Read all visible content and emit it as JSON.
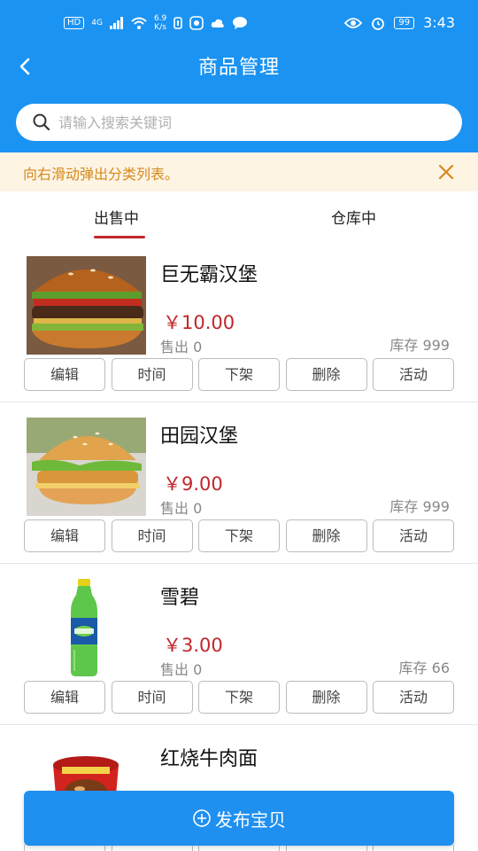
{
  "status_bar": {
    "hd": "HD",
    "net": "4G",
    "speed_value": "6.9",
    "speed_unit": "K/s",
    "battery": "99",
    "time": "3:43"
  },
  "header": {
    "title": "商品管理",
    "background_color": "#1b93f2"
  },
  "search": {
    "placeholder": "请输入搜索关键词",
    "value": ""
  },
  "notice": {
    "text": "向右滑动弹出分类列表。",
    "color": "#d58a1a"
  },
  "tabs": [
    {
      "label": "出售中",
      "active": true
    },
    {
      "label": "仓库中",
      "active": false
    }
  ],
  "products": [
    {
      "name": "巨无霸汉堡",
      "price": "￥10.00",
      "sold": "售出 0",
      "stock": "库存 999",
      "image": "burger-image"
    },
    {
      "name": "田园汉堡",
      "price": "￥9.00",
      "sold": "售出 0",
      "stock": "库存 999",
      "image": "chicken-burger-image"
    },
    {
      "name": "雪碧",
      "price": "￥3.00",
      "sold": "售出 0",
      "stock": "库存 66",
      "image": "sprite-bottle-image"
    },
    {
      "name": "红烧牛肉面",
      "price": "",
      "sold": "",
      "stock": "",
      "image": "instant-noodle-image"
    }
  ],
  "actions": {
    "edit": "编辑",
    "time": "时间",
    "unlist": "下架",
    "delete": "删除",
    "activity": "活动"
  },
  "publish_button": {
    "label": "发布宝贝"
  },
  "accent_color": "#c0262b"
}
